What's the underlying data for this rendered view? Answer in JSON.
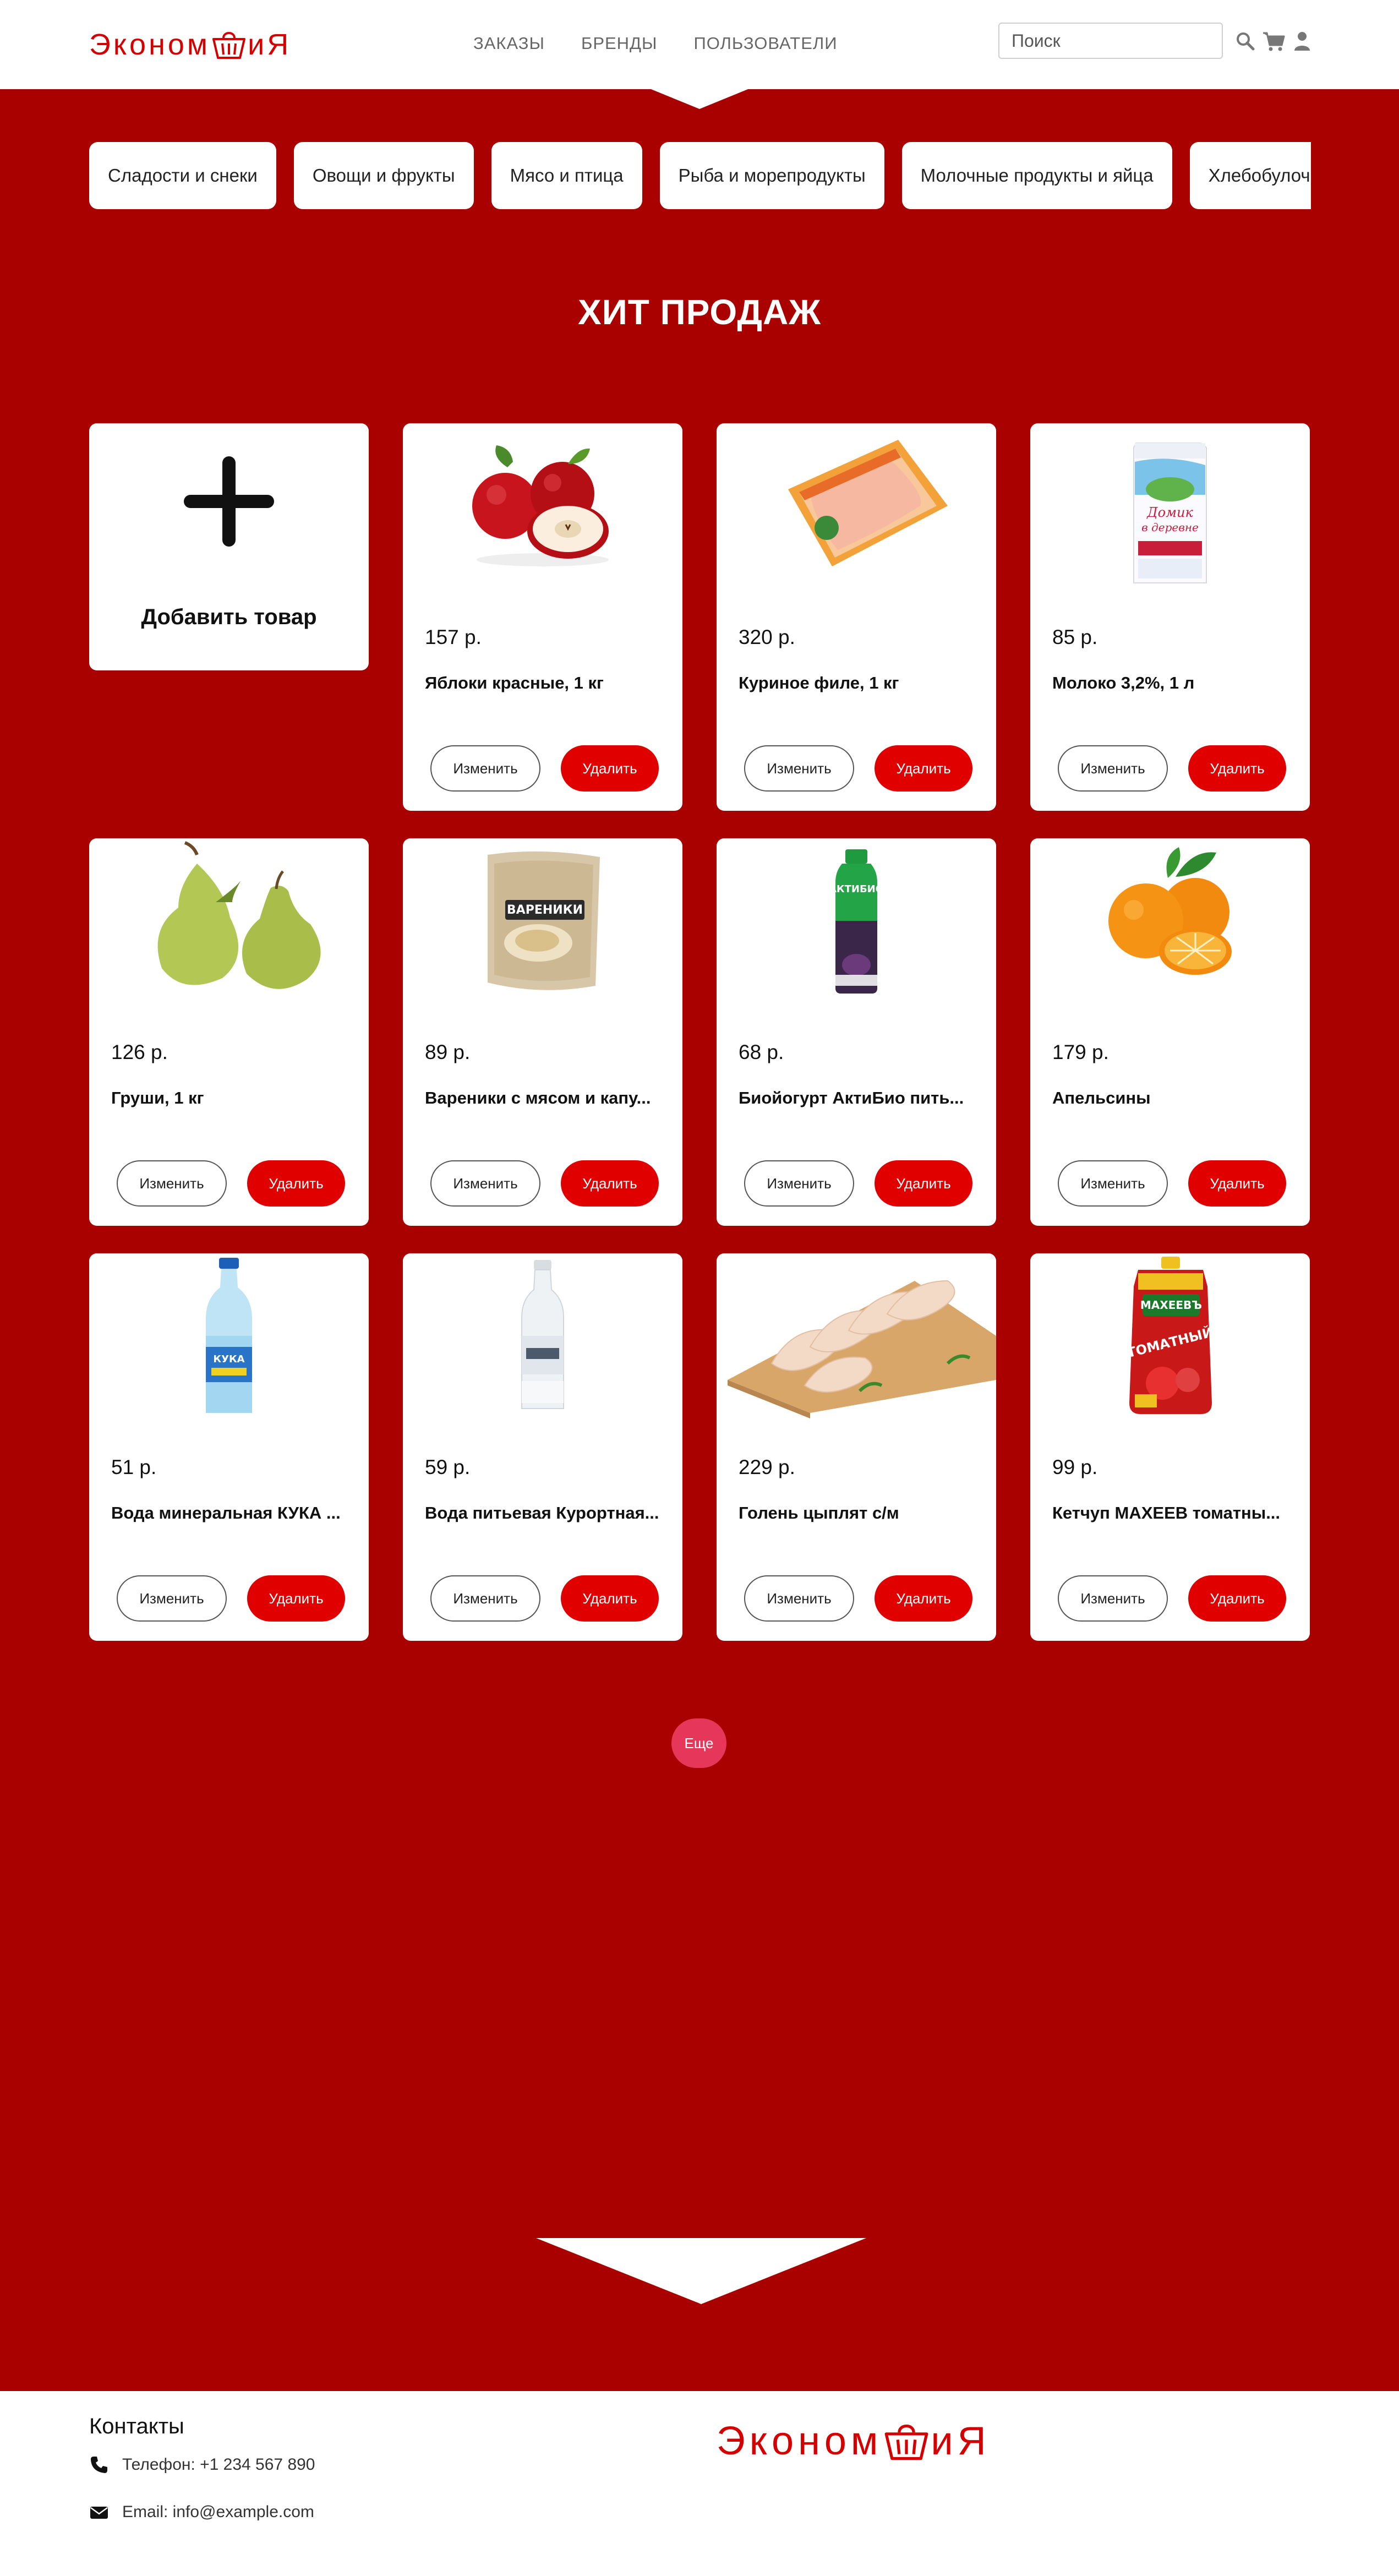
{
  "brand": {
    "name_left": "Эконом",
    "name_right": "иЯ",
    "color": "#d40000"
  },
  "header": {
    "nav": [
      "ЗАКАЗЫ",
      "БРЕНДЫ",
      "ПОЛЬЗОВАТЕЛИ"
    ],
    "search_placeholder": "Поиск",
    "icons": [
      "search-icon",
      "cart-icon",
      "user-icon"
    ]
  },
  "categories": [
    "Сладости и снеки",
    "Овощи и фрукты",
    "Мясо и птица",
    "Рыба и морепродукты",
    "Молочные продукты и яйца",
    "Хлебобулочные изделия"
  ],
  "section_title": "ХИТ ПРОДАЖ",
  "add_card": {
    "label": "Добавить товар"
  },
  "buttons": {
    "edit": "Изменить",
    "delete": "Удалить",
    "more": "Еще"
  },
  "products": [
    {
      "price": "157 р.",
      "name": "Яблоки красные, 1 кг",
      "image": "apples"
    },
    {
      "price": "320 р.",
      "name": "Куриное филе, 1 кг",
      "image": "chicken-fillet"
    },
    {
      "price": "85 р.",
      "name": "Молоко 3,2%, 1 л",
      "image": "milk"
    },
    {
      "price": "126 р.",
      "name": "Груши, 1 кг",
      "image": "pears"
    },
    {
      "price": "89 р.",
      "name": "Вареники с мясом и капу...",
      "image": "vareniki"
    },
    {
      "price": "68 р.",
      "name": "Биойогурт АктиБио пить...",
      "image": "yogurt"
    },
    {
      "price": "179 р.",
      "name": "Апельсины",
      "image": "oranges"
    },
    {
      "price": "51 р.",
      "name": "Вода минеральная КУКА ...",
      "image": "water-blue"
    },
    {
      "price": "59 р.",
      "name": "Вода питьевая Курортная...",
      "image": "water-clear"
    },
    {
      "price": "229 р.",
      "name": "Голень цыплят с/м",
      "image": "chicken-legs"
    },
    {
      "price": "99 р.",
      "name": "Кетчуп МАХЕЕВ томатны...",
      "image": "ketchup"
    }
  ],
  "footer": {
    "contacts_title": "Контакты",
    "phone": "Телефон: +1 234 567 890",
    "email": "Email: info@example.com"
  },
  "colors": {
    "background": "#a90000",
    "accent": "#e00000",
    "more_button": "#e6375a"
  }
}
